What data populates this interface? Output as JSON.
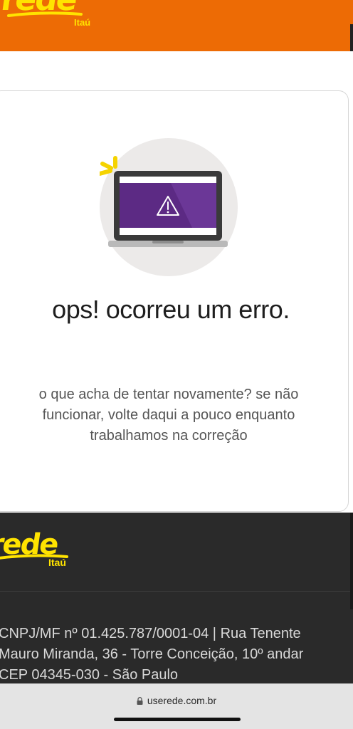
{
  "header": {
    "logo_text": "rede",
    "logo_sub": "Itaú",
    "bg_color": "#ED6B05",
    "logo_color": "#FFE300"
  },
  "error": {
    "illustration_icon": "laptop-warning-icon",
    "title": "ops! ocorreu um erro.",
    "message": "o que acha de tentar novamente? se não funcionar, volte daqui a pouco enquanto trabalhamos na correção"
  },
  "footer": {
    "logo_text": "rede",
    "logo_sub": "Itaú",
    "address_line1": "CNPJ/MF nº 01.425.787/0001-04 | Rua Tenente",
    "address_line2": "Mauro Miranda, 36 - Torre Conceição, 10º andar",
    "address_line3": "CEP 04345-030 - São Paulo",
    "bg_color": "#2a2a2a"
  },
  "browser": {
    "url": "userede.com.br",
    "lock_icon": "lock-icon"
  }
}
